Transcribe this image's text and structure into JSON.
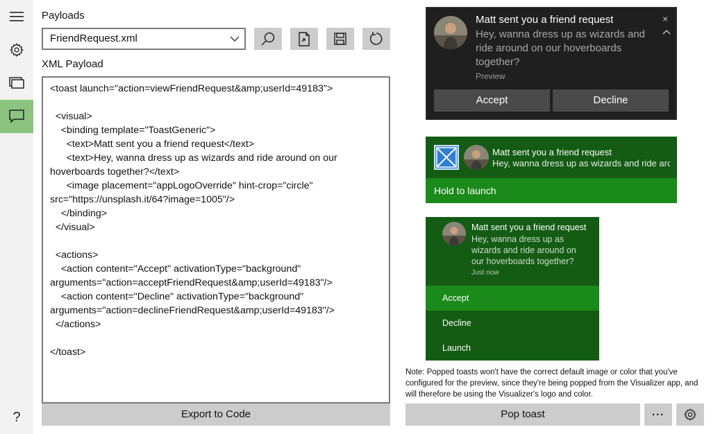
{
  "nav": {
    "items": [
      {
        "icon": "hamburger-icon"
      },
      {
        "icon": "gear-icon"
      },
      {
        "icon": "gallery-icon"
      },
      {
        "icon": "message-icon",
        "active": true
      }
    ],
    "help_glyph": "?"
  },
  "payloads": {
    "label": "Payloads",
    "selected": "FriendRequest.xml"
  },
  "toolbar": {
    "buttons": [
      "search-icon",
      "open-file-icon",
      "save-icon",
      "refresh-icon"
    ]
  },
  "editor": {
    "label": "XML Payload",
    "lines": [
      "<toast launch=\"action=viewFriendRequest&amp;userId=49183\">",
      "",
      "  <visual>",
      "    <binding template=\"ToastGeneric\">",
      "      <text>Matt sent you a friend request</text>",
      "      <text>Hey, wanna dress up as wizards and ride around on our",
      "hoverboards together?</text>",
      "      <image placement=\"appLogoOverride\" hint-crop=\"circle\"",
      "src=\"https://unsplash.it/64?image=1005\"/>",
      "    </binding>",
      "  </visual>",
      "",
      "  <actions>",
      "    <action content=\"Accept\" activationType=\"background\"",
      "arguments=\"action=acceptFriendRequest&amp;userId=49183\"/>",
      "    <action content=\"Decline\" activationType=\"background\"",
      "arguments=\"action=declineFriendRequest&amp;userId=49183\"/>",
      "  </actions>",
      "",
      "</toast>"
    ]
  },
  "export_label": "Export to Code",
  "toast_preview": {
    "title": "Matt sent you a friend request",
    "body": "Hey, wanna dress up as wizards and ride around on our hoverboards together?",
    "attribution": "Preview",
    "close_glyph": "×",
    "accept": "Accept",
    "decline": "Decline"
  },
  "toast_mobile": {
    "title": "Matt sent you a friend request",
    "body": "Hey, wanna dress up as wizards and ride arou...",
    "hold": "Hold to launch"
  },
  "toast_expanded": {
    "title": "Matt sent you a friend request",
    "body": "Hey, wanna dress up as wizards and ride around on our hoverboards together?",
    "time": "Just now",
    "actions": [
      "Accept",
      "Decline",
      "Launch"
    ]
  },
  "note": "Note: Popped toasts won't have the correct default image or color that you've configured for the preview, since they're being popped from the Visualizer app, and will therefore be using the Visualizer's logo and color.",
  "pop_label": "Pop toast",
  "more_glyph": "···",
  "colors": {
    "accent_green": "#1a8a1a",
    "dark_green": "#145c14",
    "nav_active": "#8cc47f"
  }
}
